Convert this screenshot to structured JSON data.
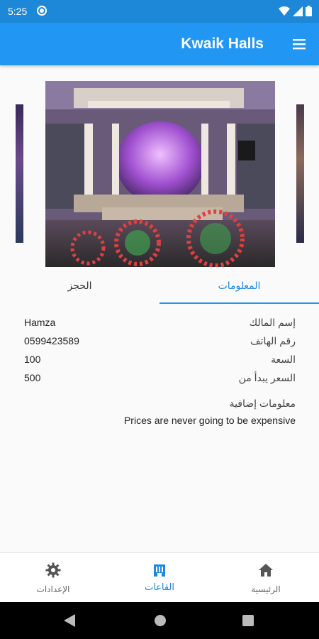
{
  "status_bar": {
    "time": "5:25"
  },
  "app_bar": {
    "title": "Kwaik Halls"
  },
  "tabs": {
    "info": "المعلومات",
    "booking": "الحجز"
  },
  "info": {
    "rows": [
      {
        "label": "إسم المالك",
        "value": "Hamza"
      },
      {
        "label": "رقم الهاتف",
        "value": "0599423589"
      },
      {
        "label": "السعة",
        "value": "100"
      },
      {
        "label": "السعر يبدأ من",
        "value": "500"
      }
    ],
    "extra_label": "معلومات إضافية",
    "extra_value": "Prices are never going to be expensive"
  },
  "bottom_nav": {
    "settings": "الإعدادات",
    "halls": "القاعات",
    "home": "الرئيسية"
  },
  "colors": {
    "primary": "#2196f3",
    "status_bar": "#1e88d8",
    "active": "#1e88e5"
  }
}
